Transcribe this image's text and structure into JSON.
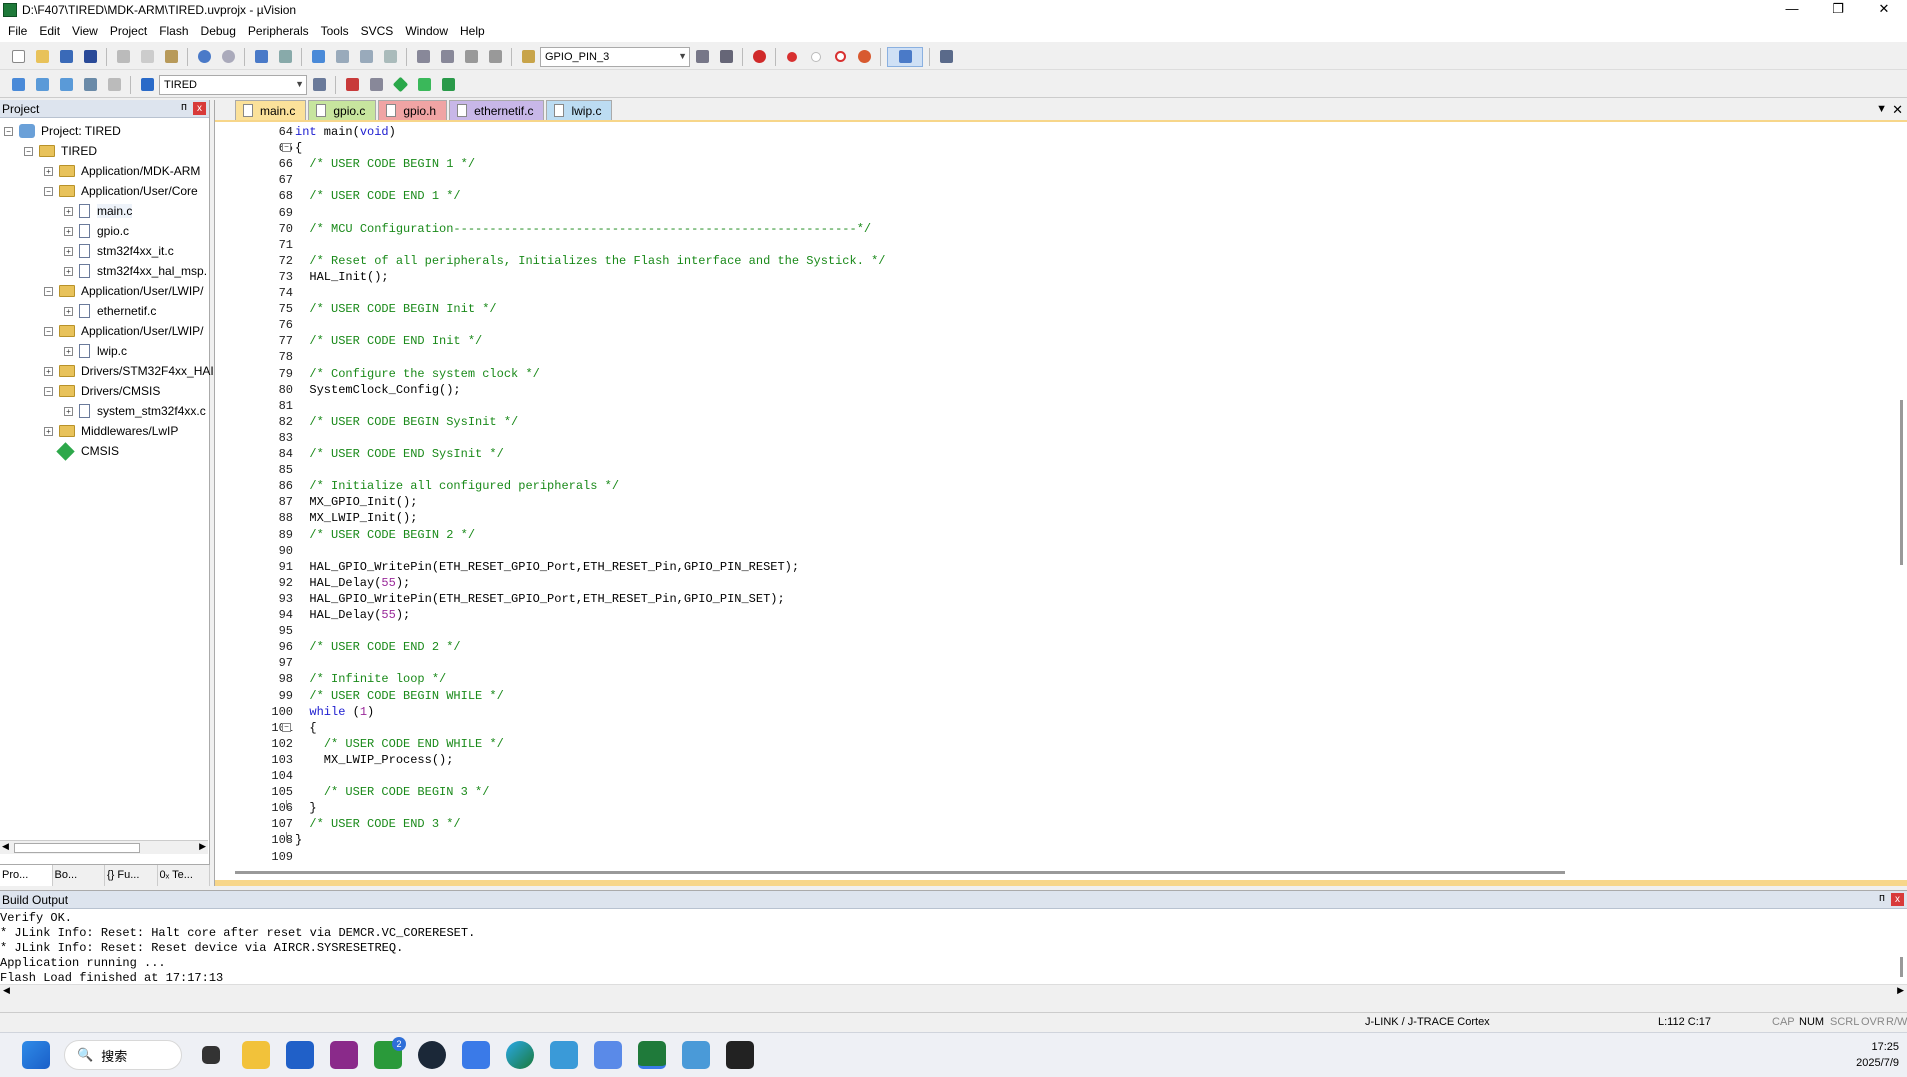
{
  "window": {
    "title": "D:\\F407\\TIRED\\MDK-ARM\\TIRED.uvprojx - µVision",
    "minimize": "—",
    "maximize": "❐",
    "close": "✕"
  },
  "menu": [
    "File",
    "Edit",
    "View",
    "Project",
    "Flash",
    "Debug",
    "Peripherals",
    "Tools",
    "SVCS",
    "Window",
    "Help"
  ],
  "toolbar": {
    "find_combo": "GPIO_PIN_3",
    "target_combo": "TIRED"
  },
  "project_panel": {
    "title": "Project",
    "pin": "ᴨ",
    "close": "x",
    "tree": [
      {
        "label": "Project: TIRED",
        "type": "project",
        "expander": "−",
        "depth": 0
      },
      {
        "label": "TIRED",
        "type": "folder",
        "expander": "−",
        "depth": 1
      },
      {
        "label": "Application/MDK-ARM",
        "type": "folder",
        "expander": "+",
        "depth": 2
      },
      {
        "label": "Application/User/Core",
        "type": "folder",
        "expander": "−",
        "depth": 2
      },
      {
        "label": "main.c",
        "type": "file",
        "expander": "+",
        "depth": 3
      },
      {
        "label": "gpio.c",
        "type": "file",
        "expander": "+",
        "depth": 3
      },
      {
        "label": "stm32f4xx_it.c",
        "type": "file",
        "expander": "+",
        "depth": 3
      },
      {
        "label": "stm32f4xx_hal_msp.",
        "type": "file",
        "expander": "+",
        "depth": 3
      },
      {
        "label": "Application/User/LWIP/",
        "type": "folder",
        "expander": "−",
        "depth": 2
      },
      {
        "label": "ethernetif.c",
        "type": "file",
        "expander": "+",
        "depth": 3
      },
      {
        "label": "Application/User/LWIP/",
        "type": "folder",
        "expander": "−",
        "depth": 2
      },
      {
        "label": "lwip.c",
        "type": "file",
        "expander": "+",
        "depth": 3
      },
      {
        "label": "Drivers/STM32F4xx_HAI",
        "type": "folder",
        "expander": "+",
        "depth": 2
      },
      {
        "label": "Drivers/CMSIS",
        "type": "folder",
        "expander": "−",
        "depth": 2
      },
      {
        "label": "system_stm32f4xx.c",
        "type": "file",
        "expander": "+",
        "depth": 3
      },
      {
        "label": "Middlewares/LwIP",
        "type": "folder",
        "expander": "+",
        "depth": 2
      },
      {
        "label": "CMSIS",
        "type": "cmsis",
        "expander": "",
        "depth": 2
      }
    ],
    "bottom_tabs": [
      "Pro...",
      "Bo...",
      "{} Fu...",
      "0ₓ Te..."
    ]
  },
  "editor": {
    "tabs": [
      "main.c",
      "gpio.c",
      "gpio.h",
      "ethernetif.c",
      "lwip.c"
    ],
    "active_tab": "main.c",
    "tab_menu": "▼",
    "tab_close": "✕",
    "lines": [
      {
        "n": "64",
        "t": "int main(void)",
        "style": "kwline",
        "fold": ""
      },
      {
        "n": "65",
        "t": "{",
        "style": "plain",
        "fold": "−"
      },
      {
        "n": "66",
        "t": "  /* USER CODE BEGIN 1 */",
        "style": "cm",
        "fold": ""
      },
      {
        "n": "67",
        "t": "",
        "style": "plain",
        "fold": ""
      },
      {
        "n": "68",
        "t": "  /* USER CODE END 1 */",
        "style": "cm",
        "fold": ""
      },
      {
        "n": "69",
        "t": "",
        "style": "plain",
        "fold": ""
      },
      {
        "n": "70",
        "t": "  /* MCU Configuration--------------------------------------------------------*/",
        "style": "cm",
        "fold": ""
      },
      {
        "n": "71",
        "t": "",
        "style": "plain",
        "fold": ""
      },
      {
        "n": "72",
        "t": "  /* Reset of all peripherals, Initializes the Flash interface and the Systick. */",
        "style": "cm",
        "fold": ""
      },
      {
        "n": "73",
        "t": "  HAL_Init();",
        "style": "plain",
        "fold": ""
      },
      {
        "n": "74",
        "t": "",
        "style": "plain",
        "fold": ""
      },
      {
        "n": "75",
        "t": "  /* USER CODE BEGIN Init */",
        "style": "cm",
        "fold": ""
      },
      {
        "n": "76",
        "t": "",
        "style": "plain",
        "fold": ""
      },
      {
        "n": "77",
        "t": "  /* USER CODE END Init */",
        "style": "cm",
        "fold": ""
      },
      {
        "n": "78",
        "t": "",
        "style": "plain",
        "fold": ""
      },
      {
        "n": "79",
        "t": "  /* Configure the system clock */",
        "style": "cm",
        "fold": ""
      },
      {
        "n": "80",
        "t": "  SystemClock_Config();",
        "style": "plain",
        "fold": ""
      },
      {
        "n": "81",
        "t": "",
        "style": "plain",
        "fold": ""
      },
      {
        "n": "82",
        "t": "  /* USER CODE BEGIN SysInit */",
        "style": "cm",
        "fold": ""
      },
      {
        "n": "83",
        "t": "",
        "style": "plain",
        "fold": ""
      },
      {
        "n": "84",
        "t": "  /* USER CODE END SysInit */",
        "style": "cm",
        "fold": ""
      },
      {
        "n": "85",
        "t": "",
        "style": "plain",
        "fold": ""
      },
      {
        "n": "86",
        "t": "  /* Initialize all configured peripherals */",
        "style": "cm",
        "fold": ""
      },
      {
        "n": "87",
        "t": "  MX_GPIO_Init();",
        "style": "plain",
        "fold": ""
      },
      {
        "n": "88",
        "t": "  MX_LWIP_Init();",
        "style": "plain",
        "fold": ""
      },
      {
        "n": "89",
        "t": "  /* USER CODE BEGIN 2 */",
        "style": "cm",
        "fold": ""
      },
      {
        "n": "90",
        "t": "",
        "style": "plain",
        "fold": ""
      },
      {
        "n": "91",
        "t": "  HAL_GPIO_WritePin(ETH_RESET_GPIO_Port,ETH_RESET_Pin,GPIO_PIN_RESET);",
        "style": "plain",
        "fold": ""
      },
      {
        "n": "92",
        "t": "  HAL_Delay(55);",
        "style": "delay",
        "fold": ""
      },
      {
        "n": "93",
        "t": "  HAL_GPIO_WritePin(ETH_RESET_GPIO_Port,ETH_RESET_Pin,GPIO_PIN_SET);",
        "style": "plain",
        "fold": ""
      },
      {
        "n": "94",
        "t": "  HAL_Delay(55);",
        "style": "delay",
        "fold": ""
      },
      {
        "n": "95",
        "t": "",
        "style": "plain",
        "fold": ""
      },
      {
        "n": "96",
        "t": "  /* USER CODE END 2 */",
        "style": "cm",
        "fold": ""
      },
      {
        "n": "97",
        "t": "",
        "style": "plain",
        "fold": ""
      },
      {
        "n": "98",
        "t": "  /* Infinite loop */",
        "style": "cm",
        "fold": ""
      },
      {
        "n": "99",
        "t": "  /* USER CODE BEGIN WHILE */",
        "style": "cm",
        "fold": ""
      },
      {
        "n": "100",
        "t": "  while (1)",
        "style": "while",
        "fold": ""
      },
      {
        "n": "101",
        "t": "  {",
        "style": "plain",
        "fold": "−"
      },
      {
        "n": "102",
        "t": "    /* USER CODE END WHILE */",
        "style": "cm",
        "fold": ""
      },
      {
        "n": "103",
        "t": "    MX_LWIP_Process();",
        "style": "plain",
        "fold": ""
      },
      {
        "n": "104",
        "t": "",
        "style": "plain",
        "fold": ""
      },
      {
        "n": "105",
        "t": "    /* USER CODE BEGIN 3 */",
        "style": "cm",
        "fold": ""
      },
      {
        "n": "106",
        "t": "  }",
        "style": "plain",
        "fold": "end"
      },
      {
        "n": "107",
        "t": "  /* USER CODE END 3 */",
        "style": "cm",
        "fold": ""
      },
      {
        "n": "108",
        "t": "}",
        "style": "plain",
        "fold": "end"
      },
      {
        "n": "109",
        "t": "",
        "style": "plain",
        "fold": ""
      }
    ]
  },
  "build_output": {
    "title": "Build Output",
    "pin": "ᴨ",
    "close": "x",
    "lines": [
      "Verify OK.",
      "* JLink Info: Reset: Halt core after reset via DEMCR.VC_CORERESET.",
      "* JLink Info: Reset: Reset device via AIRCR.SYSRESETREQ.",
      "Application running ...",
      "Flash Load finished at 17:17:13"
    ]
  },
  "statusbar": {
    "debugger": "J-LINK / J-TRACE Cortex",
    "position": "L:112 C:17",
    "cap": "CAP",
    "num": "NUM",
    "scrl": "SCRL",
    "ovr": "OVR",
    "rw": "R/W"
  },
  "taskbar": {
    "search": "搜索",
    "badge": "2",
    "time": "17:25",
    "date": "2025/7/9",
    "icons": [
      "windows-start-icon",
      "task-view-icon",
      "file-explorer-icon",
      "store-icon",
      "app-icon",
      "xbox-icon",
      "steam-icon",
      "feishu-icon",
      "edge-icon",
      "stm32cubemx-icon",
      "bird-icon",
      "keil-uvision-icon",
      "image-viewer-icon",
      "terminal-icon"
    ]
  }
}
